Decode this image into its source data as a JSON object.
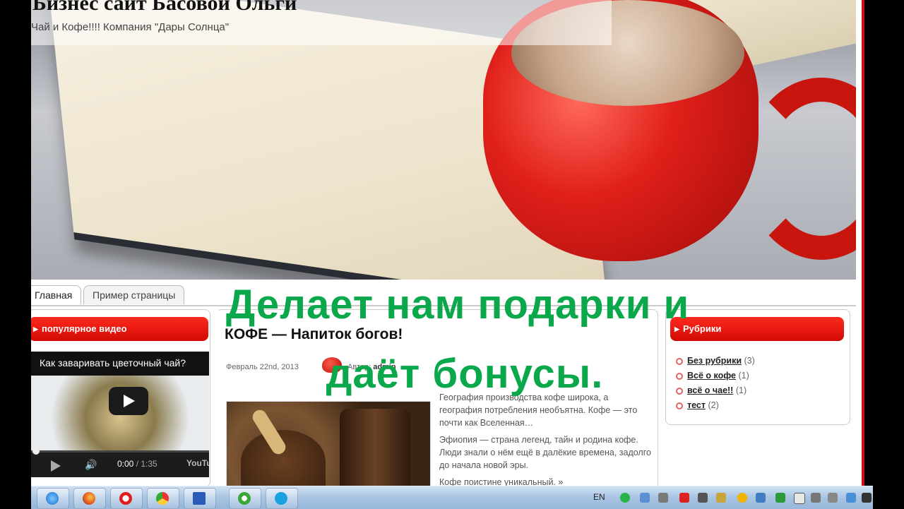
{
  "site": {
    "title": "Бизнес сайт Басовой Ольги",
    "subtitle": "Чай и Кофе!!!! Компания \"Дары Солнца\""
  },
  "nav": {
    "tabs": [
      "Главная",
      "Пример страницы"
    ]
  },
  "video_widget": {
    "heading": "популярное видео",
    "video_title": "Как заваривать цветочный чай?",
    "time_current": "0:00",
    "time_separator": " / ",
    "time_total": "1:35",
    "brand": "YouTube",
    "progress": 0
  },
  "post": {
    "title": "КОФЕ — Напиток богов!",
    "date": "Февраль 22nd, 2013",
    "author_label": "Автор:",
    "author": "admin",
    "paragraphs": [
      "География производства кофе широка, а география потребления необъятна. Кофе — это почти как Вселенная…",
      "Эфиопия — страна легенд, тайн и родина кофе. Люди знали о нём ещё в далёкие времена, задолго до начала новой эры."
    ],
    "read_more": "Кофе поистине уникальный. »"
  },
  "categories": {
    "heading": "Рубрики",
    "items": [
      {
        "label": "Без рубрики",
        "count": "(3)"
      },
      {
        "label": "Всё о кофе",
        "count": "(1)"
      },
      {
        "label": "всё о чае!!",
        "count": "(1)"
      },
      {
        "label": "тест",
        "count": "(2)"
      }
    ]
  },
  "overlay": {
    "line1": "Делает нам подарки и",
    "line2": "даёт бонусы."
  },
  "taskbar": {
    "language": "EN",
    "apps": [
      "internet-explorer-icon",
      "firefox-icon",
      "opera-icon",
      "chrome-icon",
      "word-icon",
      "utorrent-icon",
      "skype-icon"
    ]
  },
  "colors": {
    "accent_red": "#d00a04",
    "overlay_green": "#0aa84a"
  }
}
